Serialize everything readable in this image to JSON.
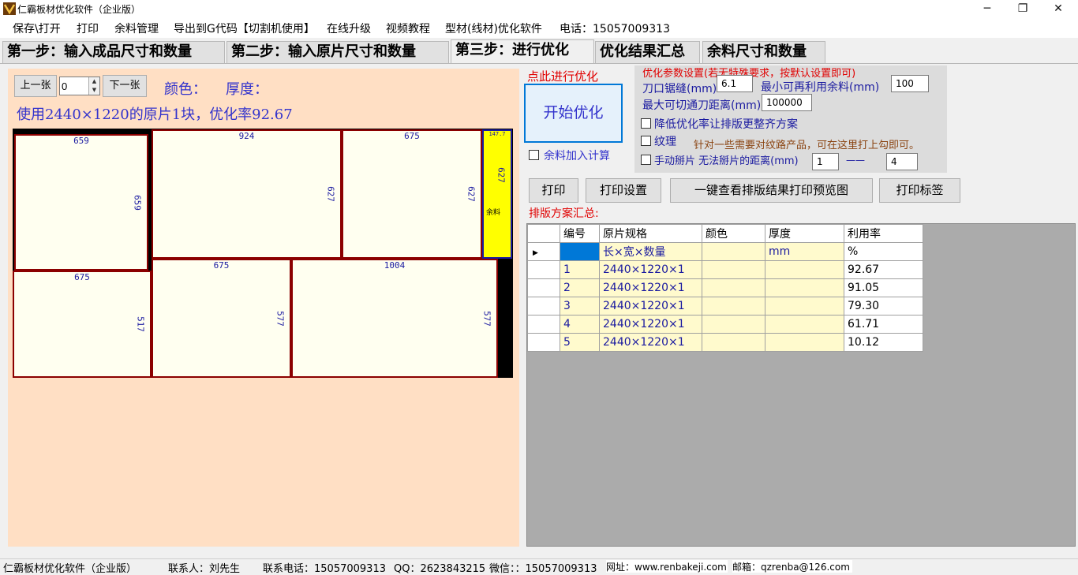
{
  "window": {
    "title": "仁霸板材优化软件（企业版）",
    "minimize": "─",
    "restore": "❐",
    "close": "✕"
  },
  "menu": [
    "保存\\打开",
    "打印",
    "余料管理",
    "导出到G代码【切割机使用】",
    "在线升级",
    "视频教程",
    "型材(线材)优化软件",
    "电话：15057009313"
  ],
  "tabs": [
    "第一步：输入成品尺寸和数量",
    "第二步：输入原片尺寸和数量",
    "第三步：进行优化",
    "优化结果汇总",
    "余料尺寸和数量"
  ],
  "active_tab": 2,
  "nav": {
    "prev": "上一张",
    "next": "下一张",
    "page_value": "0",
    "color_label": "颜色：",
    "thickness_label": "厚度：",
    "summary": "使用2440×1220的原片1块，优化率92.67"
  },
  "pieces": [
    {
      "w": "659",
      "h": "659"
    },
    {
      "w": "924",
      "h": "627"
    },
    {
      "w": "675",
      "h": "627"
    },
    {
      "w": "147.7",
      "h": "627",
      "label": "余料"
    },
    {
      "w": "675",
      "h": "517"
    },
    {
      "w": "675",
      "h": "577"
    },
    {
      "w": "1004",
      "h": "577"
    }
  ],
  "optimize": {
    "hint": "点此进行优化",
    "start": "开始优化",
    "include_scrap": "余料加入计算"
  },
  "params": {
    "title": "优化参数设置(若无特殊要求，按默认设置即可)",
    "kerf_label": "刀口锯缝(mm)",
    "kerf_value": "6.1",
    "min_reuse_label": "最小可再利用余料(mm)",
    "min_reuse_value": "100",
    "max_cut_label": "最大可切通刀距离(mm)",
    "max_cut_value": "100000",
    "reduce_rate": "降低优化率让排版更整齐方案",
    "grain": "纹理",
    "grain_hint": "针对一些需要对纹路产品，可在这里打上勾即可。",
    "manual_break": "手动掰片 无法掰片的距离(mm)",
    "break_from": "1",
    "break_sep": "——",
    "break_to": "4"
  },
  "actions": [
    "打印",
    "打印设置",
    "一键查看排版结果打印预览图",
    "打印标签"
  ],
  "summary_title": "排版方案汇总:",
  "grid": {
    "headers": [
      "编号",
      "原片规格",
      "颜色",
      "厚度",
      "利用率"
    ],
    "unit_row": [
      "",
      "长×宽×数量",
      "",
      "mm",
      "%"
    ],
    "rows": [
      [
        "1",
        "2440×1220×1",
        "",
        "",
        "92.67"
      ],
      [
        "2",
        "2440×1220×1",
        "",
        "",
        "91.05"
      ],
      [
        "3",
        "2440×1220×1",
        "",
        "",
        "79.30"
      ],
      [
        "4",
        "2440×1220×1",
        "",
        "",
        "61.71"
      ],
      [
        "5",
        "2440×1220×1",
        "",
        "",
        "10.12"
      ]
    ]
  },
  "status": {
    "app": "仁霸板材优化软件（企业版）",
    "contact": "联系人：刘先生",
    "phone": "联系电话：15057009313",
    "qq": "QQ：2623843215",
    "wechat": "微信：：15057009313",
    "website": "网址：www.renbakeji.com",
    "email": "邮箱：qzrenba@126.com"
  }
}
